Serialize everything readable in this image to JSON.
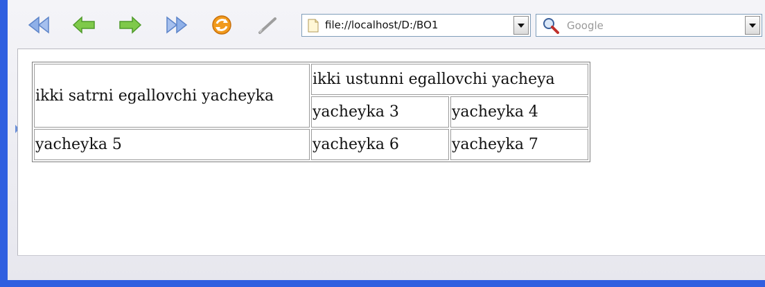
{
  "toolbar": {
    "buttons": [
      {
        "name": "rewind-button",
        "icon": "rewind-icon"
      },
      {
        "name": "back-button",
        "icon": "back-arrow-icon"
      },
      {
        "name": "forward-button",
        "icon": "forward-arrow-icon"
      },
      {
        "name": "fast-forward-button",
        "icon": "fast-forward-icon"
      },
      {
        "name": "reload-button",
        "icon": "reload-icon"
      },
      {
        "name": "edit-button",
        "icon": "pencil-icon"
      }
    ],
    "address": "file://localhost/D:/BO1",
    "search_placeholder": "Google"
  },
  "table": {
    "rowspan_cell": "ikki satrni egallovchi yacheyka",
    "colspan_cell": "ikki ustunni egallovchi yacheya",
    "row2": [
      "yacheyka 3",
      "yacheyka 4"
    ],
    "row3": [
      "yacheyka 5",
      "yacheyka 6",
      "yacheyka 7"
    ]
  },
  "colors": {
    "window_border": "#2f5fe0",
    "nav_blue": "#8fb0e8",
    "nav_green": "#7fc94a",
    "reload_orange": "#f19a1c"
  }
}
